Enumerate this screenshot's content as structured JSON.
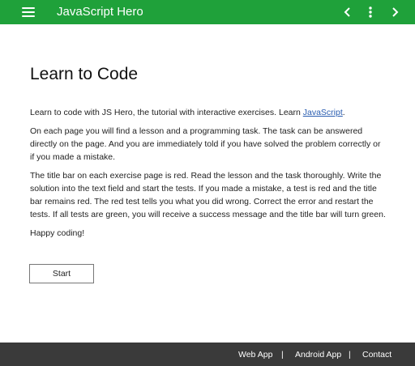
{
  "header": {
    "title": "JavaScript Hero",
    "bg_color": "#1fa13a",
    "icons": [
      "menu-icon",
      "chevron-left-icon",
      "more-vertical-icon",
      "chevron-right-icon"
    ]
  },
  "main": {
    "heading": "Learn to Code",
    "intro_prefix": "Learn to code with JS Hero, the tutorial with interactive exercises. Learn ",
    "intro_link": "JavaScript",
    "intro_suffix": ".",
    "paragraph2": "On each page you will find a lesson and a programming task. The task can be answered directly on the page. And you are immediately told if you have solved the problem correctly or if you made a mistake.",
    "paragraph3": "The title bar on each exercise page is red. Read the lesson and the task thoroughly. Write the solution into the text field and start the tests. If you made a mistake, a test is red and the title bar remains red. The red test tells you what you did wrong. Correct the error and restart the tests. If all tests are green, you will receive a success message and the title bar will turn green.",
    "paragraph4": "Happy coding!",
    "start_button": "Start"
  },
  "footer": {
    "links": [
      "Web App",
      "Android App",
      "Contact"
    ],
    "separator": "|"
  }
}
